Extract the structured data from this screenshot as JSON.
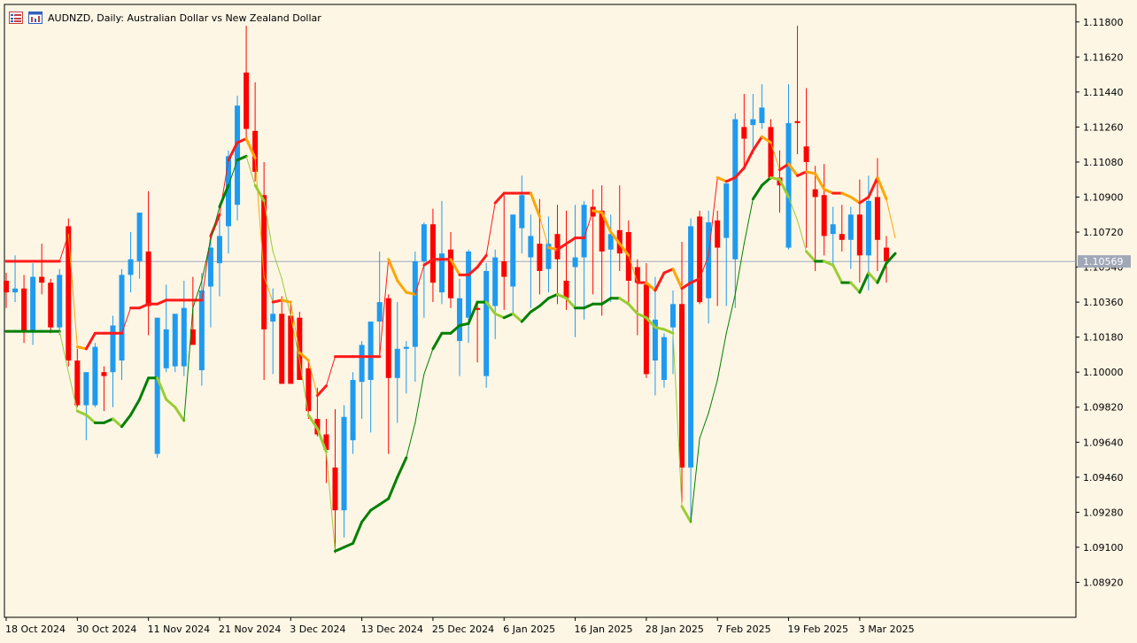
{
  "title": {
    "symbol": "AUDNZD",
    "text": "AUDNZD, Daily:  Australian Dollar vs New Zealand Dollar",
    "icons": [
      "chart-list-icon",
      "chart-window-icon"
    ]
  },
  "colors": {
    "background": "#fdf6e5",
    "bull": "#1e9bf0",
    "bear": "#ff0000",
    "upper": "#ff1a1a",
    "upper_alt": "#ffa500",
    "lower": "#008000",
    "lower_alt": "#9acd32",
    "price_line": "#a0a8c0",
    "price_label_bg": "#a0a8b8"
  },
  "chart_data": {
    "type": "candlestick",
    "symbol": "AUDNZD",
    "timeframe": "Daily",
    "ylim": [
      1.0874,
      1.1189
    ],
    "y_ticks": [
      "1.11800",
      "1.11620",
      "1.11440",
      "1.11260",
      "1.11080",
      "1.10900",
      "1.10720",
      "1.10540",
      "1.10360",
      "1.10180",
      "1.10000",
      "1.09820",
      "1.09640",
      "1.09460",
      "1.09280",
      "1.09100",
      "1.08920"
    ],
    "current_price": "1.10569",
    "x_labels": [
      {
        "label": "18 Oct 2024",
        "index": 0
      },
      {
        "label": "30 Oct 2024",
        "index": 8
      },
      {
        "label": "11 Nov 2024",
        "index": 16
      },
      {
        "label": "21 Nov 2024",
        "index": 24
      },
      {
        "label": "3 Dec 2024",
        "index": 32
      },
      {
        "label": "13 Dec 2024",
        "index": 40
      },
      {
        "label": "25 Dec 2024",
        "index": 48
      },
      {
        "label": "6 Jan 2025",
        "index": 56
      },
      {
        "label": "16 Jan 2025",
        "index": 64
      },
      {
        "label": "28 Jan 2025",
        "index": 72
      },
      {
        "label": "7 Feb 2025",
        "index": 80
      },
      {
        "label": "19 Feb 2025",
        "index": 88
      },
      {
        "label": "3 Mar 2025",
        "index": 96
      }
    ],
    "candles": [
      [
        1.1047,
        1.1051,
        1.1033,
        1.1041
      ],
      [
        1.1041,
        1.106,
        1.1036,
        1.1043
      ],
      [
        1.1043,
        1.105,
        1.1015,
        1.1021
      ],
      [
        1.1021,
        1.1056,
        1.1014,
        1.1049
      ],
      [
        1.1049,
        1.1066,
        1.104,
        1.1046
      ],
      [
        1.1046,
        1.1048,
        1.102,
        1.1023
      ],
      [
        1.1023,
        1.1053,
        1.1019,
        1.105
      ],
      [
        1.1075,
        1.1079,
        1.1003,
        1.1006
      ],
      [
        1.1006,
        1.1012,
        1.0982,
        1.0983
      ],
      [
        1.0983,
        1.1,
        1.0965,
        1.1
      ],
      [
        1.0983,
        1.1015,
        1.0982,
        1.1013
      ],
      [
        1.1,
        1.1003,
        1.098,
        1.0998
      ],
      [
        1.1,
        1.1029,
        1.0982,
        1.1024
      ],
      [
        1.1006,
        1.1053,
        1.0996,
        1.105
      ],
      [
        1.105,
        1.1072,
        1.1041,
        1.1058
      ],
      [
        1.1057,
        1.1074,
        1.1048,
        1.1082
      ],
      [
        1.1062,
        1.1093,
        1.1019,
        1.1034
      ],
      [
        1.0958,
        1.1028,
        1.0956,
        1.1028
      ],
      [
        1.1002,
        1.1045,
        1.1,
        1.1022
      ],
      [
        1.1003,
        1.1026,
        1.1,
        1.103
      ],
      [
        1.1003,
        1.1047,
        1.0998,
        1.1033
      ],
      [
        1.1022,
        1.1049,
        1.1022,
        1.1014
      ],
      [
        1.1001,
        1.1051,
        1.0993,
        1.1042
      ],
      [
        1.1044,
        1.107,
        1.1023,
        1.1064
      ],
      [
        1.1056,
        1.1079,
        1.1039,
        1.107
      ],
      [
        1.1075,
        1.1114,
        1.1061,
        1.1111
      ],
      [
        1.1086,
        1.1142,
        1.1078,
        1.1137
      ],
      [
        1.1154,
        1.1178,
        1.112,
        1.1125
      ],
      [
        1.1124,
        1.1149,
        1.1098,
        1.1103
      ],
      [
        1.1091,
        1.1108,
        1.0996,
        1.1022
      ],
      [
        1.1026,
        1.1043,
        1.0999,
        1.103
      ],
      [
        1.103,
        1.1039,
        1.1014,
        1.0994
      ],
      [
        1.1029,
        1.1036,
        1.0996,
        1.0994
      ],
      [
        1.1028,
        1.1031,
        1.1,
        1.0996
      ],
      [
        1.1002,
        1.1006,
        1.0976,
        1.098
      ],
      [
        1.0976,
        1.0992,
        1.0967,
        1.0968
      ],
      [
        1.0968,
        1.0976,
        1.0943,
        1.096
      ],
      [
        1.0951,
        1.0981,
        1.0907,
        1.0929
      ],
      [
        1.0929,
        1.0983,
        1.0915,
        1.0977
      ],
      [
        1.0965,
        1.1,
        1.0958,
        1.0996
      ],
      [
        1.0995,
        1.1016,
        1.0976,
        1.1014
      ],
      [
        1.0996,
        1.1015,
        1.0969,
        1.1026
      ],
      [
        1.1026,
        1.1062,
        1.1009,
        1.1036
      ],
      [
        1.1038,
        1.104,
        1.0958,
        1.0997
      ],
      [
        1.0997,
        1.1036,
        1.0974,
        1.1012
      ],
      [
        1.1012,
        1.1016,
        1.0989,
        1.1013
      ],
      [
        1.1013,
        1.1062,
        1.0995,
        1.1057
      ],
      [
        1.1057,
        1.1077,
        1.1028,
        1.1076
      ],
      [
        1.1076,
        1.1084,
        1.1036,
        1.1046
      ],
      [
        1.1041,
        1.1088,
        1.1035,
        1.1061
      ],
      [
        1.1063,
        1.1072,
        1.1033,
        1.1038
      ],
      [
        1.1016,
        1.1048,
        1.0998,
        1.1038
      ],
      [
        1.1028,
        1.1063,
        1.1015,
        1.1062
      ],
      [
        1.1033,
        1.1035,
        1.1005,
        1.1032
      ],
      [
        1.0998,
        1.1056,
        1.0992,
        1.1052
      ],
      [
        1.1034,
        1.1063,
        1.1017,
        1.1059
      ],
      [
        1.1057,
        1.1091,
        1.1032,
        1.1049
      ],
      [
        1.1044,
        1.107,
        1.103,
        1.1081
      ],
      [
        1.1074,
        1.1101,
        1.1061,
        1.1091
      ],
      [
        1.1059,
        1.1081,
        1.1033,
        1.107
      ],
      [
        1.1066,
        1.1089,
        1.104,
        1.1052
      ],
      [
        1.1053,
        1.108,
        1.1041,
        1.1066
      ],
      [
        1.1071,
        1.1086,
        1.1035,
        1.1058
      ],
      [
        1.1047,
        1.1083,
        1.1032,
        1.1038
      ],
      [
        1.1054,
        1.1086,
        1.1018,
        1.1059
      ],
      [
        1.1059,
        1.1088,
        1.1027,
        1.1086
      ],
      [
        1.1085,
        1.1094,
        1.104,
        1.108
      ],
      [
        1.1083,
        1.1096,
        1.1029,
        1.1062
      ],
      [
        1.1063,
        1.1081,
        1.1036,
        1.1071
      ],
      [
        1.1073,
        1.1096,
        1.1052,
        1.1061
      ],
      [
        1.1072,
        1.1078,
        1.1035,
        1.1047
      ],
      [
        1.1054,
        1.1058,
        1.1019,
        1.1046
      ],
      [
        1.1045,
        1.1056,
        1.0997,
        1.0999
      ],
      [
        1.1006,
        1.1049,
        1.0988,
        1.1027
      ],
      [
        1.0996,
        1.102,
        1.0992,
        1.1018
      ],
      [
        1.1023,
        1.1042,
        1.0999,
        1.1035
      ],
      [
        1.1035,
        1.1067,
        1.0933,
        1.0951
      ],
      [
        1.0951,
        1.1079,
        1.0924,
        1.1075
      ],
      [
        1.108,
        1.1083,
        1.1035,
        1.1036
      ],
      [
        1.1038,
        1.1083,
        1.1025,
        1.1077
      ],
      [
        1.1078,
        1.1083,
        1.1034,
        1.1064
      ],
      [
        1.1069,
        1.1097,
        1.1034,
        1.1097
      ],
      [
        1.1058,
        1.1133,
        1.1033,
        1.113
      ],
      [
        1.1126,
        1.1143,
        1.1104,
        1.112
      ],
      [
        1.1127,
        1.1143,
        1.1112,
        1.113
      ],
      [
        1.1128,
        1.1148,
        1.1125,
        1.1136
      ],
      [
        1.1126,
        1.113,
        1.1099,
        1.11
      ],
      [
        1.11,
        1.1114,
        1.1082,
        1.1096
      ],
      [
        1.1064,
        1.1148,
        1.1063,
        1.1128
      ],
      [
        1.1129,
        1.1178,
        1.1112,
        1.1128
      ],
      [
        1.1116,
        1.1146,
        1.1064,
        1.1108
      ],
      [
        1.1094,
        1.1106,
        1.1052,
        1.109
      ],
      [
        1.1091,
        1.1107,
        1.106,
        1.107
      ],
      [
        1.1071,
        1.1085,
        1.1054,
        1.1076
      ],
      [
        1.1071,
        1.1086,
        1.1062,
        1.1068
      ],
      [
        1.1068,
        1.1085,
        1.1053,
        1.1081
      ],
      [
        1.1081,
        1.1099,
        1.1046,
        1.106
      ],
      [
        1.106,
        1.1101,
        1.1042,
        1.1088
      ],
      [
        1.109,
        1.111,
        1.1052,
        1.1068
      ],
      [
        1.1064,
        1.107,
        1.1046,
        1.1057
      ]
    ],
    "upper_line": [
      1.1057,
      1.1057,
      1.1057,
      1.1057,
      1.1057,
      1.1057,
      1.1057,
      1.1071,
      1.1013,
      1.1012,
      1.102,
      1.102,
      1.102,
      1.102,
      1.1033,
      1.1033,
      1.1035,
      1.1035,
      1.1037,
      1.1037,
      1.1037,
      1.1037,
      1.1037,
      1.107,
      1.1081,
      1.1109,
      1.1118,
      1.112,
      1.111,
      1.1049,
      1.1036,
      1.1037,
      1.1036,
      1.101,
      1.1006,
      1.0988,
      1.0993,
      1.1008,
      1.1008,
      1.1008,
      1.1008,
      1.1008,
      1.1008,
      1.1058,
      1.1047,
      1.1041,
      1.104,
      1.1055,
      1.1058,
      1.1058,
      1.1058,
      1.105,
      1.105,
      1.1054,
      1.106,
      1.1087,
      1.1092,
      1.1092,
      1.1092,
      1.1092,
      1.108,
      1.1064,
      1.1063,
      1.1066,
      1.1069,
      1.1069,
      1.1083,
      1.1082,
      1.1072,
      1.1066,
      1.106,
      1.1046,
      1.1046,
      1.1042,
      1.1051,
      1.1053,
      1.1043,
      1.1046,
      1.1048,
      1.106,
      1.11,
      1.1098,
      1.11,
      1.1105,
      1.1114,
      1.1121,
      1.1118,
      1.1104,
      1.1107,
      1.1101,
      1.1103,
      1.1102,
      1.1094,
      1.1092,
      1.1092,
      1.109,
      1.1087,
      1.109,
      1.11,
      1.1089,
      1.1069
    ],
    "lower_line": [
      1.1021,
      1.1021,
      1.1021,
      1.1021,
      1.1021,
      1.1021,
      1.1021,
      1.1,
      1.098,
      1.0978,
      1.0974,
      1.0974,
      1.0976,
      1.0972,
      1.0978,
      1.0986,
      1.0997,
      1.0997,
      1.0986,
      1.0982,
      1.0975,
      1.1033,
      1.1047,
      1.1068,
      1.1085,
      1.1096,
      1.1109,
      1.1111,
      1.1096,
      1.1088,
      1.1062,
      1.1048,
      1.1029,
      1.1006,
      1.0978,
      1.0971,
      1.0959,
      1.0908,
      1.091,
      1.0912,
      1.0923,
      1.0929,
      1.0932,
      1.0935,
      1.0946,
      1.0956,
      1.0974,
      1.0999,
      1.1012,
      1.102,
      1.102,
      1.1024,
      1.1025,
      1.1036,
      1.1036,
      1.103,
      1.1028,
      1.103,
      1.1026,
      1.1031,
      1.1034,
      1.1038,
      1.104,
      1.1038,
      1.1033,
      1.1033,
      1.1035,
      1.1035,
      1.1038,
      1.1038,
      1.1035,
      1.103,
      1.1028,
      1.1023,
      1.1022,
      1.102,
      1.0931,
      1.0923,
      1.0966,
      1.0979,
      1.0996,
      1.102,
      1.104,
      1.1066,
      1.1089,
      1.1096,
      1.11,
      1.1099,
      1.109,
      1.1078,
      1.1062,
      1.1057,
      1.1057,
      1.1055,
      1.1046,
      1.1046,
      1.1041,
      1.1051,
      1.1046,
      1.1056,
      1.1061
    ]
  }
}
